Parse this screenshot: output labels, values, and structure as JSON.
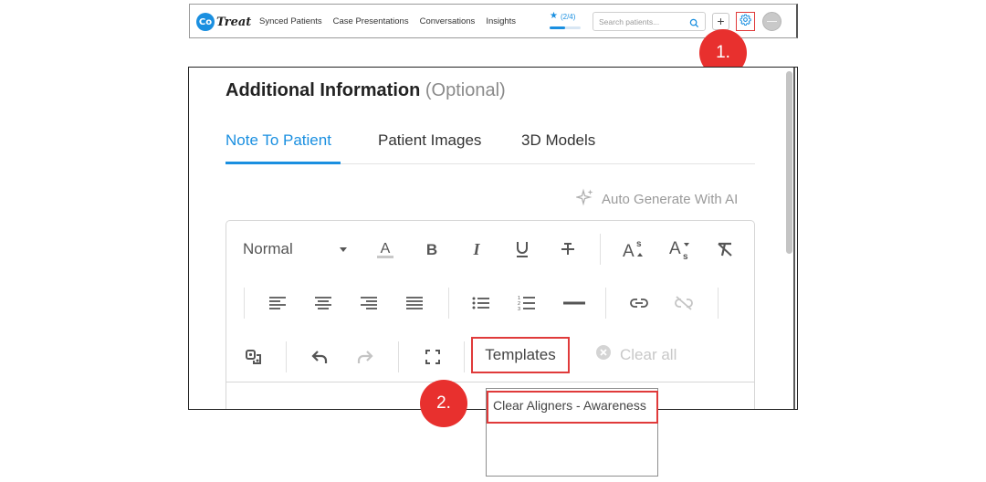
{
  "navbar": {
    "logo_mark": "Co",
    "logo_text": "Treat",
    "links": [
      "Synced Patients",
      "Case Presentations",
      "Conversations",
      "Insights"
    ],
    "progress_label": "(2/4)",
    "progress_fraction": 0.5,
    "search_placeholder": "Search patients...",
    "add_symbol": "+",
    "icons": [
      "star-icon",
      "search-icon",
      "gear-icon",
      "avatar"
    ]
  },
  "markers": {
    "one": "1.",
    "two": "2."
  },
  "panel": {
    "title": "Additional Information",
    "title_optional": "(Optional)",
    "tabs": [
      {
        "label": "Note To Patient",
        "active": true
      },
      {
        "label": "Patient Images",
        "active": false
      },
      {
        "label": "3D Models",
        "active": false
      }
    ],
    "auto_generate_label": "Auto Generate With AI",
    "toolbar": {
      "heading_value": "Normal",
      "row1_icons": [
        "text-color-icon",
        "bold-icon",
        "italic-icon",
        "underline-icon",
        "strikethrough-icon",
        "superscript-icon",
        "subscript-icon",
        "clear-format-icon"
      ],
      "row2_icons": [
        "align-left-icon",
        "align-center-icon",
        "align-right-icon",
        "align-justify-icon",
        "bullet-list-icon",
        "numbered-list-icon",
        "horizontal-rule-icon",
        "link-icon",
        "unlink-icon"
      ],
      "row3_icons": [
        "copy-format-icon",
        "undo-icon",
        "redo-icon",
        "fullscreen-icon"
      ],
      "templates_label": "Templates",
      "clear_all_label": "Clear all"
    }
  },
  "dropdown": {
    "items": [
      "Clear Aligners - Awareness"
    ]
  },
  "colors": {
    "accent": "#1a8fe0",
    "highlight": "#e03a3a",
    "marker": "#e8302e"
  }
}
